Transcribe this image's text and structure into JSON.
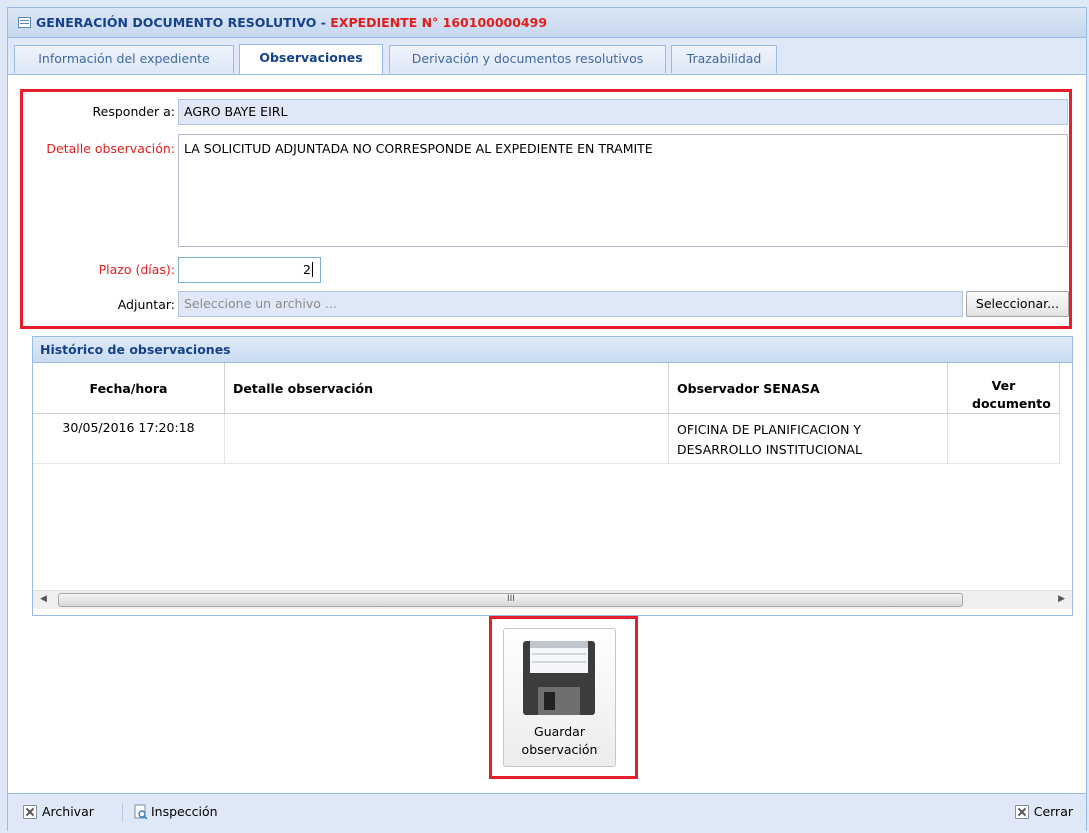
{
  "window": {
    "title_prefix": "GENERACIÓN DOCUMENTO RESOLUTIVO",
    "title_sep": " - ",
    "title_highlight": "EXPEDIENTE N° 160100000499"
  },
  "tabs": [
    {
      "label": "Información del expediente",
      "active": false
    },
    {
      "label": "Observaciones",
      "active": true
    },
    {
      "label": "Derivación y documentos resolutivos",
      "active": false
    },
    {
      "label": "Trazabilidad",
      "active": false
    }
  ],
  "form": {
    "responder_label": "Responder a:",
    "responder_value": "AGRO BAYE EIRL",
    "detalle_label": "Detalle observación:",
    "detalle_value": "LA SOLICITUD ADJUNTADA NO CORRESPONDE AL EXPEDIENTE EN TRAMITE",
    "plazo_label": "Plazo (días):",
    "plazo_value": "2",
    "adjuntar_label": "Adjuntar:",
    "adjuntar_placeholder": "Seleccione un archivo ...",
    "seleccionar_label": "Seleccionar..."
  },
  "history": {
    "title": "Histórico de observaciones",
    "columns": [
      "Fecha/hora",
      "Detalle observación",
      "Observador SENASA",
      "Ver documento"
    ],
    "rows": [
      {
        "fecha": "30/05/2016 17:20:18",
        "detalle": "",
        "observador": "OFICINA DE PLANIFICACION Y DESARROLLO INSTITUCIONAL",
        "ver": ""
      }
    ],
    "scroll_grip": "III"
  },
  "actions": {
    "save_label": "Guardar observación",
    "archivar_label": "Archivar",
    "inspeccion_label": "Inspección",
    "cerrar_label": "Cerrar"
  },
  "colors": {
    "accent_red": "#e11d1d",
    "title_blue": "#15428b",
    "panel_bg": "#dfe8f6",
    "border_blue": "#99bbe8"
  }
}
